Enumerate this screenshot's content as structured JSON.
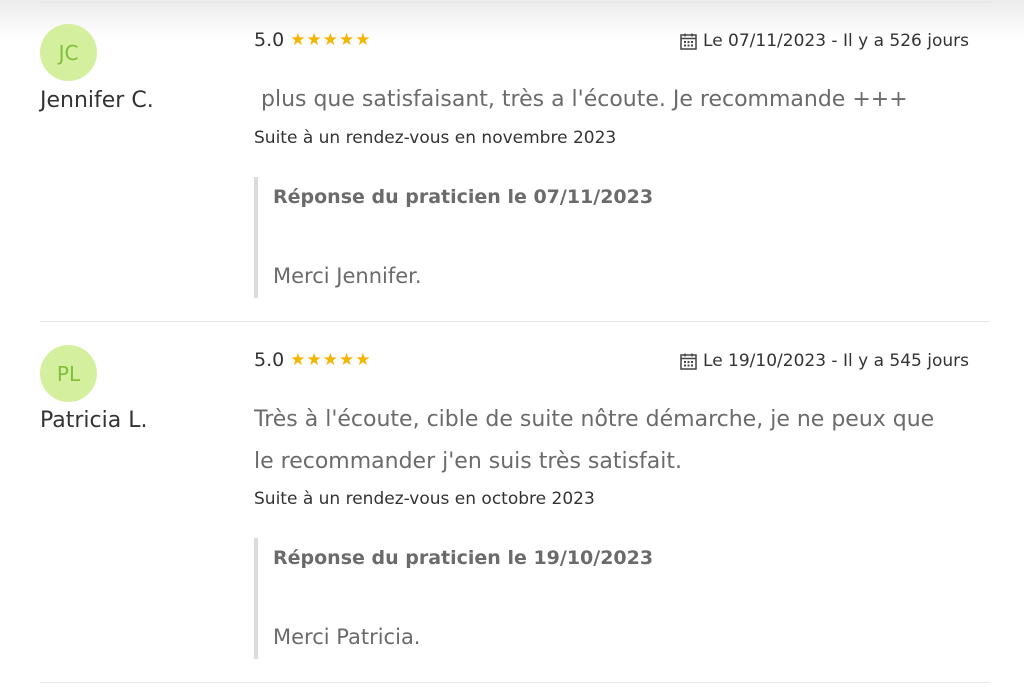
{
  "reviews": [
    {
      "initials": "JC",
      "author": "Jennifer C.",
      "rating": "5.0",
      "stars": 5,
      "date": "Le 07/11/2023 - Il y a 526 jours",
      "comment": " plus que satisfaisant, très a l'écoute. Je recommande +++",
      "context": "Suite à un rendez-vous en novembre 2023",
      "reply_title": "Réponse du praticien le 07/11/2023",
      "reply_text": "Merci Jennifer."
    },
    {
      "initials": "PL",
      "author": "Patricia L.",
      "rating": "5.0",
      "stars": 5,
      "date": "Le 19/10/2023 - Il y a 545 jours",
      "comment": "Très à l'écoute, cible de suite nôtre démarche, je ne peux que le recommander j'en suis très satisfait.",
      "context": "Suite à un rendez-vous en octobre 2023",
      "reply_title": "Réponse du praticien le 19/10/2023",
      "reply_text": "Merci Patricia."
    }
  ],
  "icons": {
    "star": "star-icon",
    "calendar": "calendar-icon"
  },
  "colors": {
    "avatar_bg": "#d4ef9d",
    "avatar_text": "#7fbf3a",
    "star": "#f4b400",
    "reply_border": "#dcdce0",
    "muted_text": "#6b6b6b"
  }
}
